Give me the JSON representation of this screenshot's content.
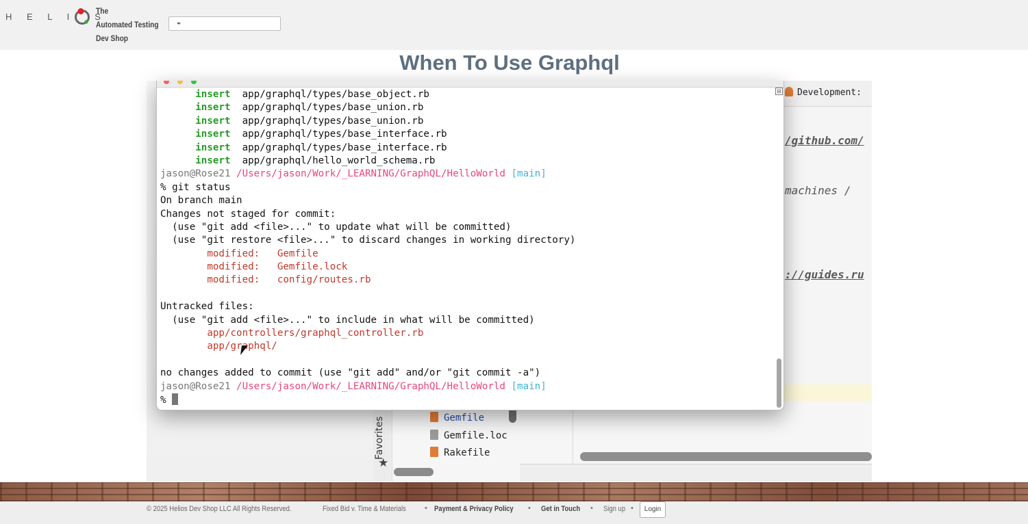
{
  "header": {
    "logo_letters_left": "H E L I",
    "logo_letters_right": "S",
    "tagline": [
      "The",
      "Automated Testing",
      "Dev Shop"
    ],
    "select_value": ""
  },
  "page": {
    "title": "When To Use Graphql"
  },
  "terminal": {
    "lines": [
      [
        {
          "t": "      insert",
          "c": "green"
        },
        {
          "t": "  app/graphql/types/base_object.rb",
          "c": ""
        }
      ],
      [
        {
          "t": "      insert",
          "c": "green"
        },
        {
          "t": "  app/graphql/types/base_union.rb",
          "c": ""
        }
      ],
      [
        {
          "t": "      insert",
          "c": "green"
        },
        {
          "t": "  app/graphql/types/base_union.rb",
          "c": ""
        }
      ],
      [
        {
          "t": "      insert",
          "c": "green"
        },
        {
          "t": "  app/graphql/types/base_interface.rb",
          "c": ""
        }
      ],
      [
        {
          "t": "      insert",
          "c": "green"
        },
        {
          "t": "  app/graphql/types/base_interface.rb",
          "c": ""
        }
      ],
      [
        {
          "t": "      insert",
          "c": "green"
        },
        {
          "t": "  app/graphql/hello_world_schema.rb",
          "c": ""
        }
      ],
      [
        {
          "t": "jason@Rose21 ",
          "c": "gray"
        },
        {
          "t": "/Users/jason/Work/_LEARNING/GraphQL/HelloWorld",
          "c": "pink"
        },
        {
          "t": " [main]",
          "c": "blue"
        }
      ],
      [
        {
          "t": "% git status",
          "c": ""
        }
      ],
      [
        {
          "t": "On branch main",
          "c": ""
        }
      ],
      [
        {
          "t": "Changes not staged for commit:",
          "c": ""
        }
      ],
      [
        {
          "t": "  (use \"git add <file>...\" to update what will be committed)",
          "c": ""
        }
      ],
      [
        {
          "t": "  (use \"git restore <file>...\" to discard changes in working directory)",
          "c": ""
        }
      ],
      [
        {
          "t": "        modified:   Gemfile",
          "c": "red"
        }
      ],
      [
        {
          "t": "        modified:   Gemfile.lock",
          "c": "red"
        }
      ],
      [
        {
          "t": "        modified:   config/routes.rb",
          "c": "red"
        }
      ],
      [
        {
          "t": "",
          "c": ""
        }
      ],
      [
        {
          "t": "Untracked files:",
          "c": ""
        }
      ],
      [
        {
          "t": "  (use \"git add <file>...\" to include in what will be committed)",
          "c": ""
        }
      ],
      [
        {
          "t": "        app/controllers/graphql_controller.rb",
          "c": "red"
        }
      ],
      [
        {
          "t": "        app/graphql/",
          "c": "red"
        }
      ],
      [
        {
          "t": "",
          "c": ""
        }
      ],
      [
        {
          "t": "no changes added to commit (use \"git add\" and/or \"git commit -a\")",
          "c": ""
        }
      ],
      [
        {
          "t": "jason@Rose21 ",
          "c": "gray"
        },
        {
          "t": "/Users/jason/Work/_LEARNING/GraphQL/HelloWorld",
          "c": "pink"
        },
        {
          "t": " [main]",
          "c": "blue"
        }
      ],
      [
        {
          "t": "% ",
          "c": ""
        }
      ]
    ]
  },
  "ide": {
    "dev_label": "Development:",
    "lines": [
      {
        "text": "/github.com/",
        "link": true
      },
      {
        "text": "machines / ",
        "link": false
      },
      {
        "text": "://guides.ru",
        "link": true
      }
    ],
    "favorites_label": "Favorites",
    "files": [
      {
        "name": "Gemfile",
        "color": "#1f4aa8",
        "icon": "#e07b36"
      },
      {
        "name": "Gemfile.loc",
        "color": "#222222",
        "icon": "#9a9a9a"
      },
      {
        "name": "Rakefile",
        "color": "#222222",
        "icon": "#e07b36"
      }
    ]
  },
  "footer": {
    "copyright": "© 2025 Helios Dev Shop LLC All Rights Reserved.",
    "links": [
      "Fixed Bid v. Time & Materials",
      "Payment & Privacy Policy",
      "Get in Touch",
      "Sign up"
    ],
    "separator": "•",
    "login": "Login"
  },
  "colors": {
    "title": "#5e6f80",
    "terminal_green": "#2a9a2a",
    "terminal_red": "#c0392b",
    "terminal_pink": "#e8467c",
    "terminal_blue": "#3fb6d8"
  }
}
